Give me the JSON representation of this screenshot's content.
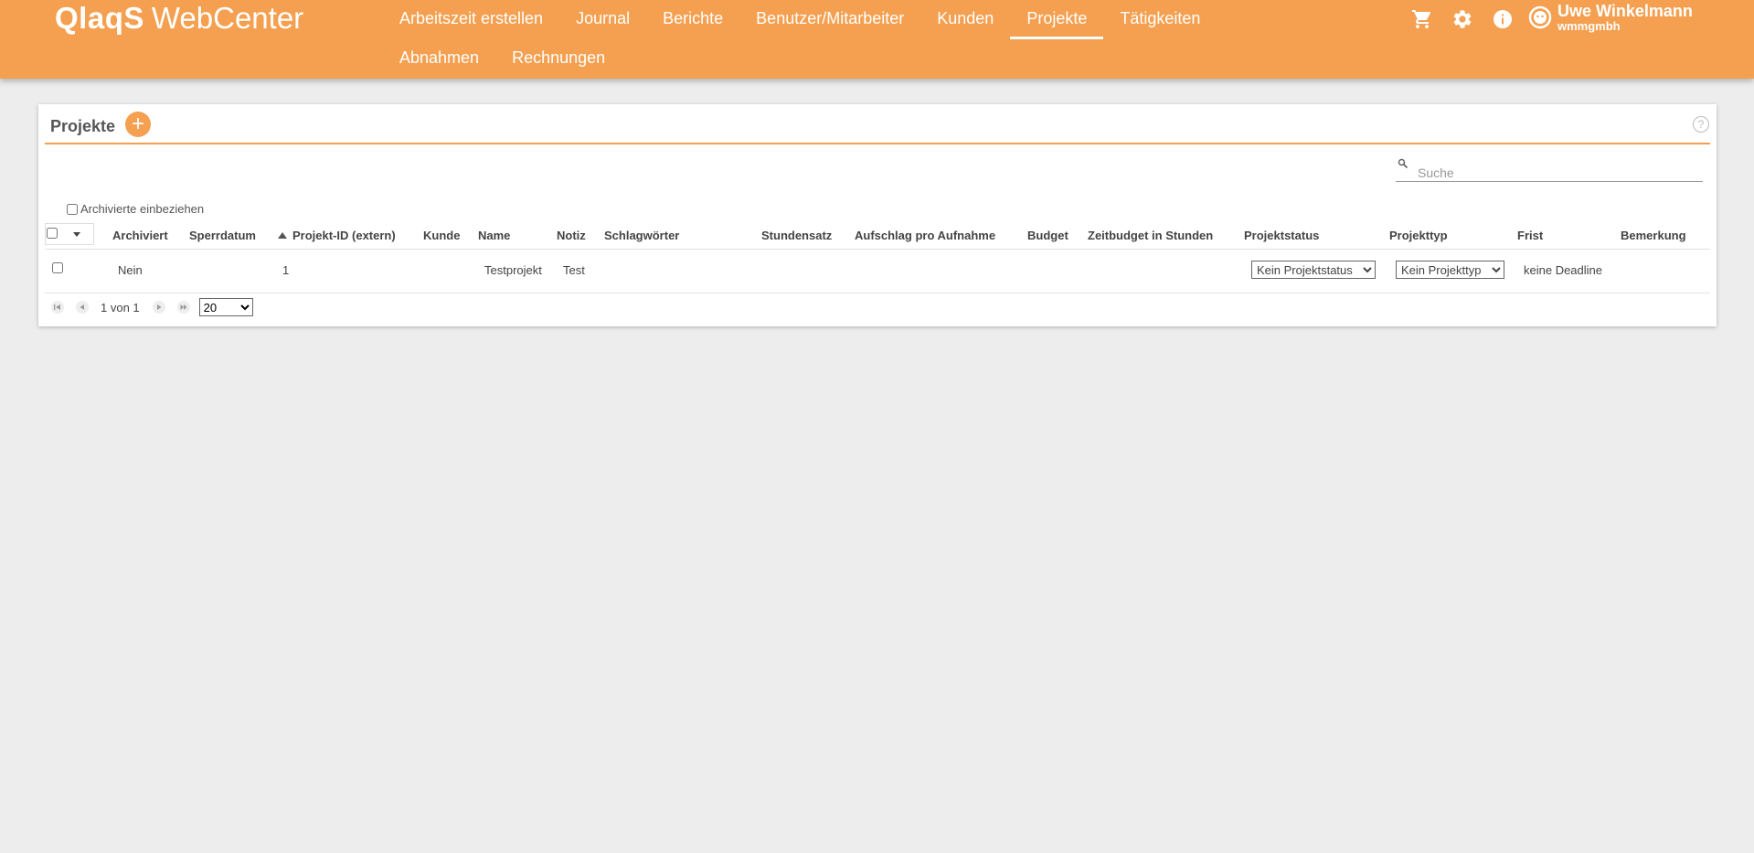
{
  "header": {
    "brand_logo": "QlaqS",
    "brand_name": "WebCenter",
    "nav": [
      {
        "label": "Arbeitszeit erstellen"
      },
      {
        "label": "Journal"
      },
      {
        "label": "Berichte"
      },
      {
        "label": "Benutzer/Mitarbeiter"
      },
      {
        "label": "Kunden"
      },
      {
        "label": "Projekte",
        "active": true
      },
      {
        "label": "Tätigkeiten"
      },
      {
        "label": "Abnahmen"
      },
      {
        "label": "Rechnungen"
      }
    ],
    "icons": [
      "cart-icon",
      "gear-icon",
      "info-icon"
    ],
    "user": {
      "name": "Uwe Winkelmann",
      "company": "wmmgmbh",
      "icon": "avatar-icon"
    },
    "accent_color": "#f4a050"
  },
  "card": {
    "title": "Projekte",
    "add_label": "+",
    "help_label": "?",
    "search_placeholder": "Suche",
    "archived_toggle_label": "Archivierte einbeziehen",
    "columns": [
      "Archiviert",
      "Sperrdatum",
      "Projekt-ID (extern)",
      "Kunde",
      "Name",
      "Notiz",
      "Schlagwörter",
      "Stundensatz",
      "Aufschlag pro Aufnahme",
      "Budget",
      "Zeitbudget in Stunden",
      "Projektstatus",
      "Projekttyp",
      "Frist",
      "Bemerkung"
    ],
    "sorted_column": "Projekt-ID (extern)",
    "rows": [
      {
        "archived": "Nein",
        "lock_date": "",
        "project_id": "1",
        "customer": "",
        "name": "Testprojekt",
        "note": "Test",
        "tags": "",
        "hourly_rate": "",
        "surcharge": "",
        "budget": "",
        "time_budget": "",
        "status": "Kein Projektstatus",
        "type": "Kein Projekttyp",
        "deadline": "keine Deadline",
        "remark": ""
      }
    ],
    "pager": {
      "text": "1 von 1",
      "page_size": "20",
      "page_size_options": [
        "20"
      ]
    }
  }
}
